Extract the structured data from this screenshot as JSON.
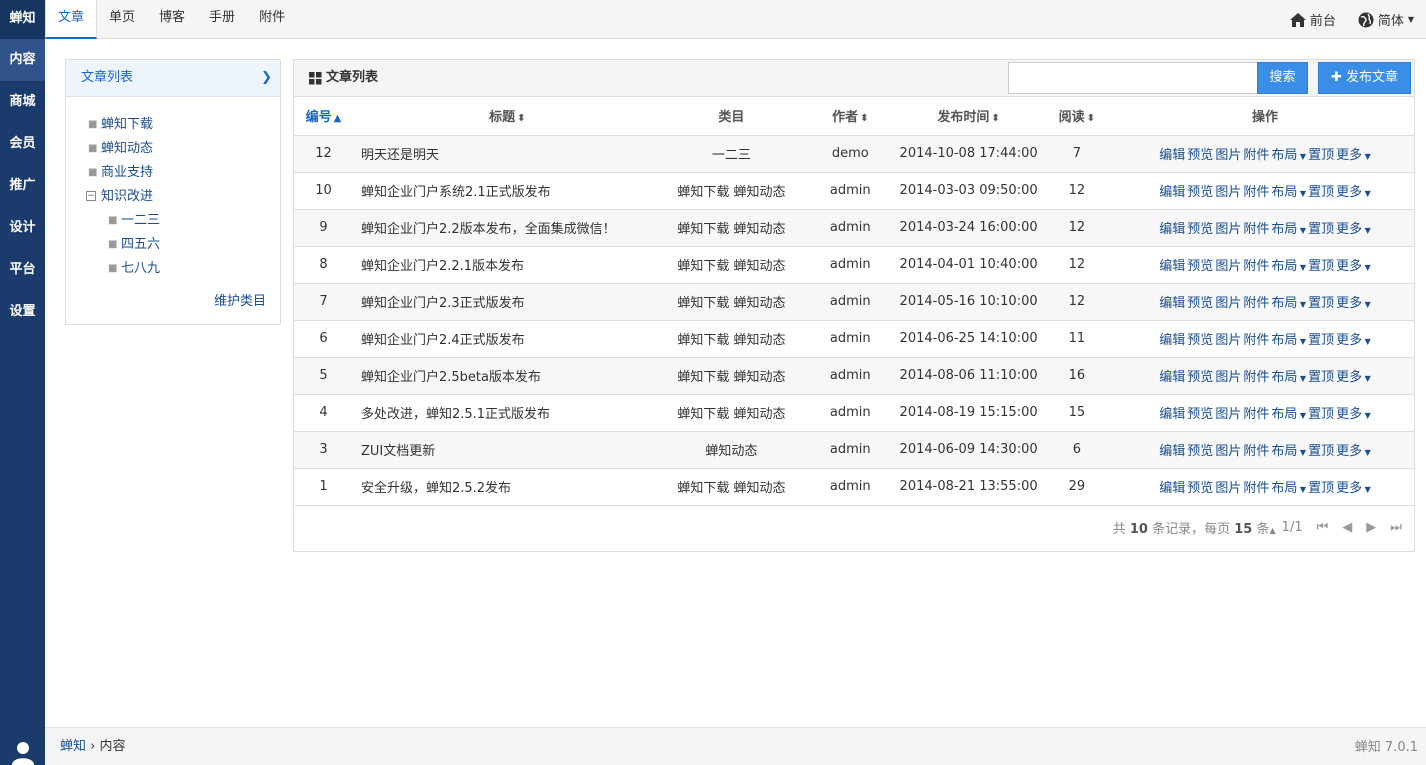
{
  "app": {
    "brand": "蝉知"
  },
  "leftnav": {
    "items": [
      "内容",
      "商城",
      "会员",
      "推广",
      "设计",
      "平台",
      "设置"
    ],
    "active": "内容"
  },
  "topbar": {
    "tabs": [
      "文章",
      "单页",
      "博客",
      "手册",
      "附件"
    ],
    "active_tab": "文章",
    "frontend": "前台",
    "language": "简体"
  },
  "tree": {
    "title": "文章列表",
    "items": [
      {
        "label": "蝉知下载"
      },
      {
        "label": "蝉知动态"
      },
      {
        "label": "商业支持"
      },
      {
        "label": "知识改进"
      },
      {
        "label": "一二三"
      },
      {
        "label": "四五六"
      },
      {
        "label": "七八九"
      }
    ],
    "maintain": "维护类目"
  },
  "list": {
    "title": "文章列表",
    "search_button": "搜索",
    "search_value": "",
    "publish_button": "发布文章",
    "columns": [
      "编号",
      "标题",
      "类目",
      "作者",
      "发布时间",
      "阅读",
      "操作"
    ],
    "actions": [
      "编辑",
      "预览",
      "图片",
      "附件",
      "布局",
      "置顶",
      "更多"
    ],
    "rows": [
      {
        "id": "12",
        "title": "明天还是明天",
        "category": "一二三",
        "author": "demo",
        "time": "2014-10-08 17:44:00",
        "views": "7"
      },
      {
        "id": "10",
        "title": "蝉知企业门户系统2.1正式版发布",
        "category": "蝉知下载 蝉知动态",
        "author": "admin",
        "time": "2014-03-03 09:50:00",
        "views": "12"
      },
      {
        "id": "9",
        "title": "蝉知企业门户2.2版本发布，全面集成微信！",
        "category": "蝉知下载 蝉知动态",
        "author": "admin",
        "time": "2014-03-24 16:00:00",
        "views": "12"
      },
      {
        "id": "8",
        "title": "蝉知企业门户2.2.1版本发布",
        "category": "蝉知下载 蝉知动态",
        "author": "admin",
        "time": "2014-04-01 10:40:00",
        "views": "12"
      },
      {
        "id": "7",
        "title": "蝉知企业门户2.3正式版发布",
        "category": "蝉知下载 蝉知动态",
        "author": "admin",
        "time": "2014-05-16 10:10:00",
        "views": "12"
      },
      {
        "id": "6",
        "title": "蝉知企业门户2.4正式版发布",
        "category": "蝉知下载 蝉知动态",
        "author": "admin",
        "time": "2014-06-25 14:10:00",
        "views": "11"
      },
      {
        "id": "5",
        "title": "蝉知企业门户2.5beta版本发布",
        "category": "蝉知下载 蝉知动态",
        "author": "admin",
        "time": "2014-08-06 11:10:00",
        "views": "16"
      },
      {
        "id": "4",
        "title": "多处改进，蝉知2.5.1正式版发布",
        "category": "蝉知下载 蝉知动态",
        "author": "admin",
        "time": "2014-08-19 15:15:00",
        "views": "15"
      },
      {
        "id": "3",
        "title": "ZUI文档更新",
        "category": "蝉知动态",
        "author": "admin",
        "time": "2014-06-09 14:30:00",
        "views": "6"
      },
      {
        "id": "1",
        "title": "安全升级，蝉知2.5.2发布",
        "category": "蝉知下载 蝉知动态",
        "author": "admin",
        "time": "2014-08-21 13:55:00",
        "views": "29"
      }
    ]
  },
  "pager": {
    "prefix": "共",
    "total": "10",
    "records": "条记录，每页",
    "per_page": "15",
    "per_page_unit": "条",
    "page": "1/1"
  },
  "footer": {
    "breadcrumb_home": "蝉知",
    "breadcrumb_current": "内容",
    "version": "蝉知 7.0.1"
  },
  "colors": {
    "sidebar": "#1a3b6b",
    "accent": "#3a8ee8",
    "link": "#1a4e8f"
  }
}
